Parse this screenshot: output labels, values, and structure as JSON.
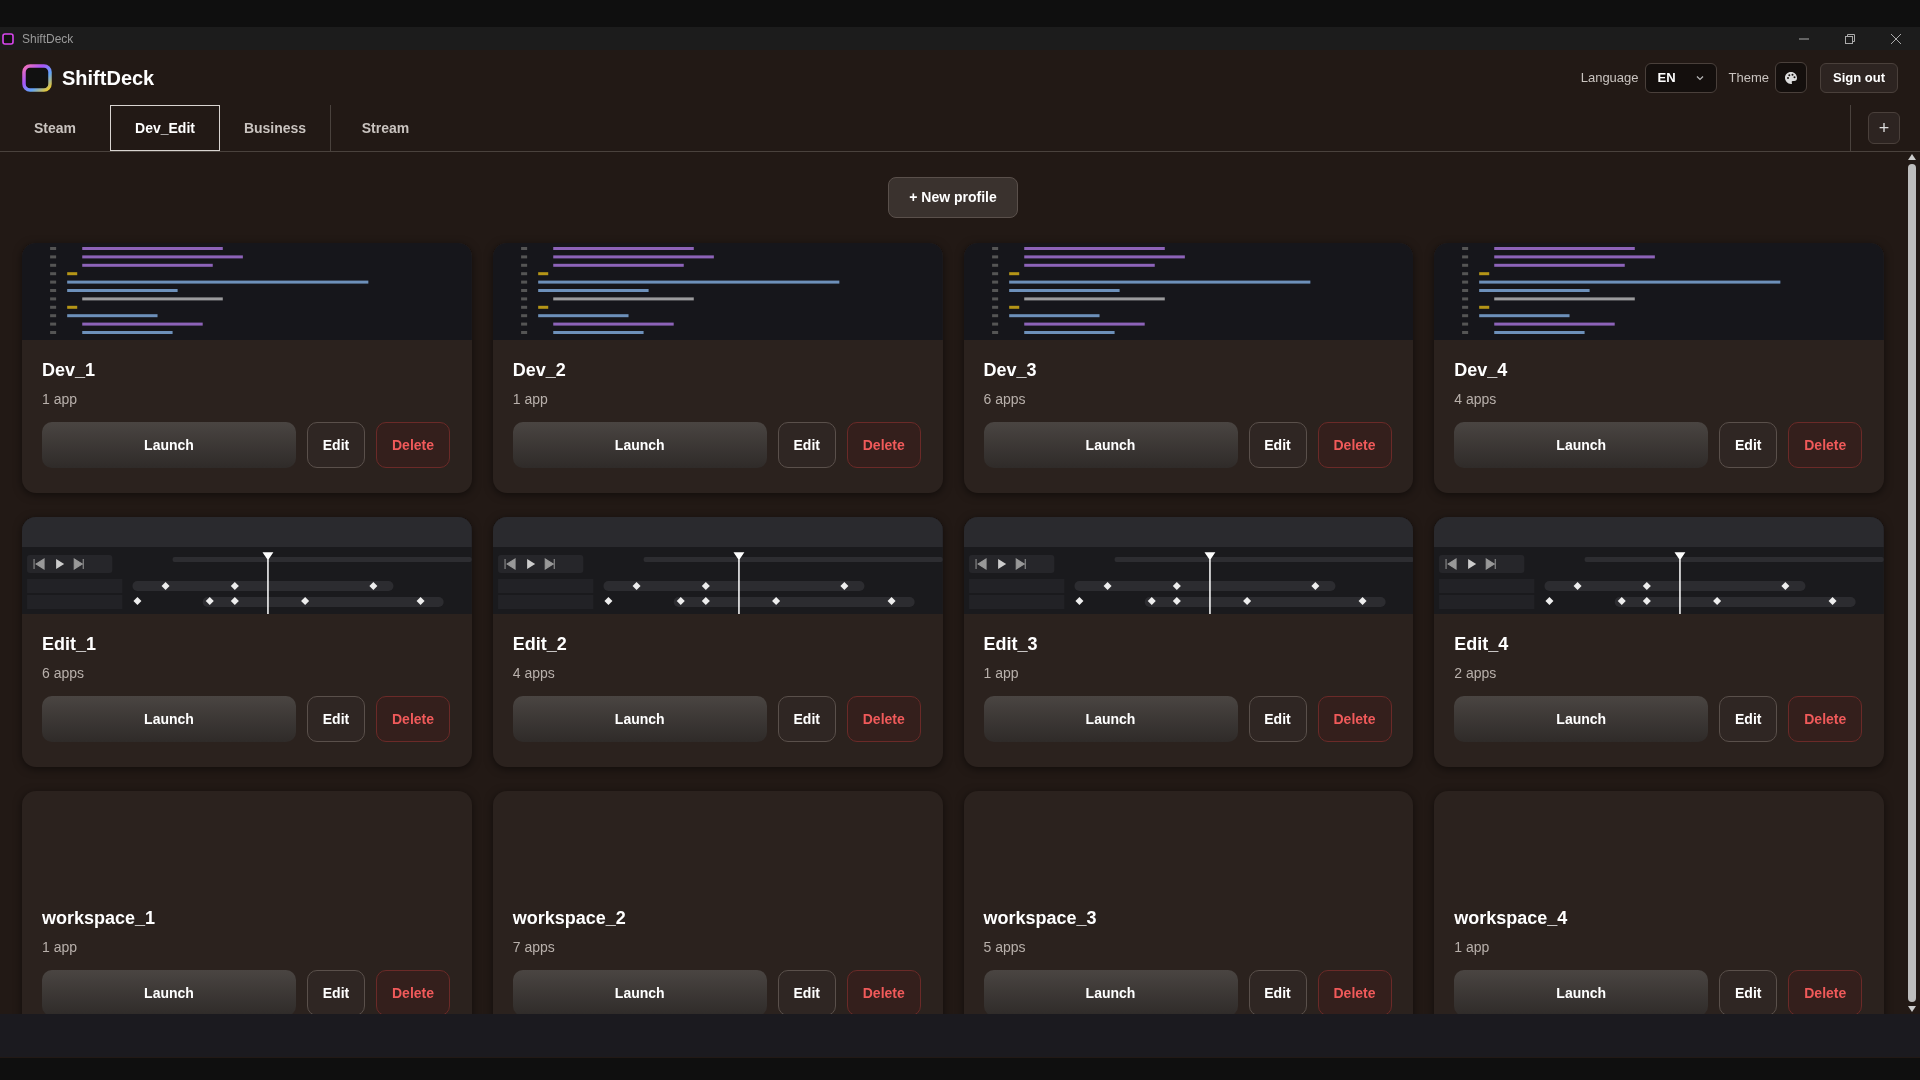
{
  "window": {
    "title": "ShiftDeck"
  },
  "header": {
    "app_name": "ShiftDeck",
    "language_label": "Language",
    "language_value": "EN",
    "theme_label": "Theme",
    "sign_out": "Sign out"
  },
  "tabs": [
    {
      "label": "Steam",
      "selected": false
    },
    {
      "label": "Dev_Edit",
      "selected": true
    },
    {
      "label": "Business",
      "selected": false
    },
    {
      "label": "Stream",
      "selected": false
    }
  ],
  "add_tab": "+",
  "new_profile": "+ New profile",
  "profiles": [
    {
      "name": "Dev_1",
      "count": "1 app",
      "kind": "code",
      "buttons": [
        "Launch",
        "Edit",
        "Delete"
      ]
    },
    {
      "name": "Dev_2",
      "count": "1 app",
      "kind": "code",
      "buttons": [
        "Launch",
        "Edit",
        "Delete"
      ]
    },
    {
      "name": "Dev_3",
      "count": "6 apps",
      "kind": "code",
      "buttons": [
        "Launch",
        "Edit",
        "Delete"
      ]
    },
    {
      "name": "Dev_4",
      "count": "4 apps",
      "kind": "code",
      "buttons": [
        "Launch",
        "Edit",
        "Delete"
      ]
    },
    {
      "name": "Edit_1",
      "count": "6 apps",
      "kind": "timeline",
      "buttons": [
        "Launch",
        "Edit",
        "Delete"
      ]
    },
    {
      "name": "Edit_2",
      "count": "4 apps",
      "kind": "timeline",
      "buttons": [
        "Launch",
        "Edit",
        "Delete"
      ]
    },
    {
      "name": "Edit_3",
      "count": "1 app",
      "kind": "timeline",
      "buttons": [
        "Launch",
        "Edit",
        "Delete"
      ]
    },
    {
      "name": "Edit_4",
      "count": "2 apps",
      "kind": "timeline",
      "buttons": [
        "Launch",
        "Edit",
        "Delete"
      ]
    },
    {
      "name": "workspace_1",
      "count": "1 app",
      "kind": "blank",
      "buttons": [
        "Launch",
        "Edit",
        "Delete"
      ]
    },
    {
      "name": "workspace_2",
      "count": "7 apps",
      "kind": "blank",
      "buttons": [
        "Launch",
        "Edit",
        "Delete"
      ]
    },
    {
      "name": "workspace_3",
      "count": "5 apps",
      "kind": "blank",
      "buttons": [
        "Launch",
        "Edit",
        "Delete"
      ]
    },
    {
      "name": "workspace_4",
      "count": "1 app",
      "kind": "blank",
      "buttons": [
        "Launch",
        "Edit",
        "Delete"
      ]
    }
  ]
}
